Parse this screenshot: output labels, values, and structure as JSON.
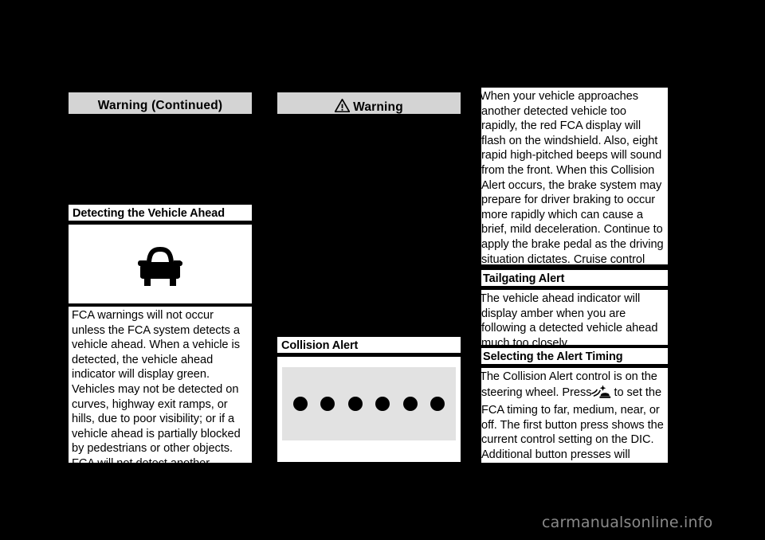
{
  "page": {
    "background_color": "#000000",
    "watermark": "carmanualsonline.info"
  },
  "columns": {
    "left": {
      "warning_banner": {
        "label": "Warning  (Continued)",
        "has_triangle_icon": false,
        "background_color": "#d4d4d4"
      },
      "section": {
        "heading": "Detecting the Vehicle Ahead",
        "figure_icon": "vehicle-ahead-car-icon",
        "body": "FCA warnings will not occur unless the FCA system detects a vehicle ahead. When a vehicle is detected, the vehicle ahead indicator will display green. Vehicles may not be detected on curves, highway exit ramps, or hills, due to poor visibility; or if a vehicle ahead is partially blocked by pedestrians or other objects. FCA will not detect another vehicle ahead until it is completely in the driving lane."
      }
    },
    "middle": {
      "warning_banner": {
        "label": "Warning",
        "has_triangle_icon": true,
        "icon_name": "warning-triangle-icon",
        "background_color": "#d4d4d4"
      },
      "section": {
        "heading": "Collision Alert",
        "figure_icon": "fca-display-dots",
        "display_strip_color": "#e2e2e2",
        "dot_count": 6,
        "dot_color": "#000000"
      }
    },
    "right": {
      "intro_body": "When your vehicle approaches another detected vehicle too rapidly, the red FCA display will flash on the windshield. Also, eight rapid high-pitched beeps will sound from the front. When this Collision Alert occurs, the brake system may prepare for driver braking to occur more rapidly which can cause a brief, mild deceleration. Continue to apply the brake pedal as the driving situation dictates. Cruise control may be disengaged when the Collision Alert occurs.",
      "sections": [
        {
          "heading": "Tailgating Alert",
          "body": "The vehicle ahead indicator will display amber when you are following a detected vehicle ahead much too closely."
        },
        {
          "heading": "Selecting the Alert Timing",
          "body_before_icon": "The Collision Alert control is on the steering wheel. Press",
          "inline_icon": "fca-collision-alert-icon",
          "body_after_icon": "to set the FCA timing to far, medium, near, or off. The first button press shows the current control setting on the DIC. Additional button presses will change this setting. The chosen"
        }
      ]
    }
  }
}
